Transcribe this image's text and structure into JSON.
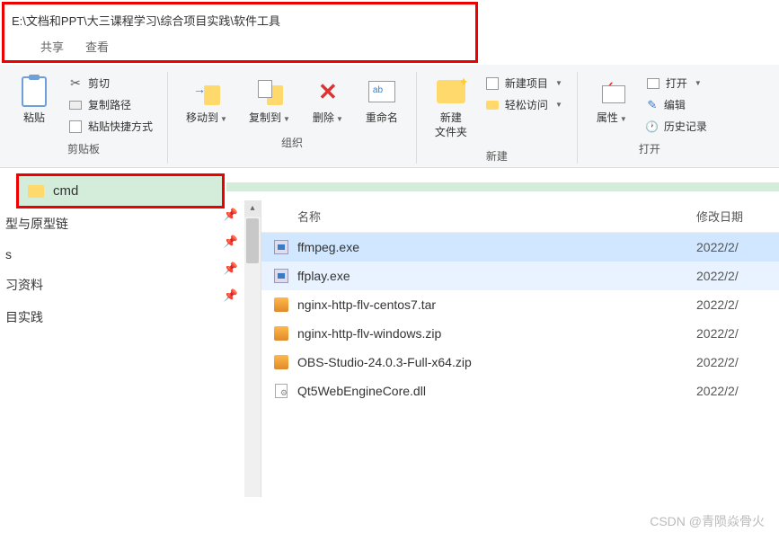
{
  "address": "E:\\文档和PPT\\大三课程学习\\综合项目实践\\软件工具",
  "tabs": {
    "share": "共享",
    "view": "查看"
  },
  "ribbon": {
    "clipboard": {
      "paste": "粘贴",
      "cut": "剪切",
      "copy_path": "复制路径",
      "paste_shortcut": "粘贴快捷方式",
      "group": "剪贴板"
    },
    "organize": {
      "move_to": "移动到",
      "copy_to": "复制到",
      "delete": "删除",
      "rename": "重命名",
      "group": "组织"
    },
    "new": {
      "new_folder": "新建\n文件夹",
      "new_item": "新建项目",
      "easy_access": "轻松访问",
      "group": "新建"
    },
    "open": {
      "properties": "属性",
      "open": "打开",
      "edit": "编辑",
      "history": "历史记录",
      "group": "打开"
    }
  },
  "breadcrumb_input": "cmd",
  "sidebar": {
    "items": [
      "型与原型链",
      "s",
      "习资料",
      "目实践"
    ]
  },
  "columns": {
    "name": "名称",
    "modified": "修改日期"
  },
  "files": [
    {
      "icon": "exe",
      "name": "ffmpeg.exe",
      "date": "2022/2/",
      "selected": true
    },
    {
      "icon": "exe",
      "name": "ffplay.exe",
      "date": "2022/2/"
    },
    {
      "icon": "zip",
      "name": "nginx-http-flv-centos7.tar",
      "date": "2022/2/"
    },
    {
      "icon": "zip",
      "name": "nginx-http-flv-windows.zip",
      "date": "2022/2/"
    },
    {
      "icon": "zip",
      "name": "OBS-Studio-24.0.3-Full-x64.zip",
      "date": "2022/2/"
    },
    {
      "icon": "dll",
      "name": "Qt5WebEngineCore.dll",
      "date": "2022/2/"
    }
  ],
  "watermark": "CSDN @青陨焱骨火"
}
